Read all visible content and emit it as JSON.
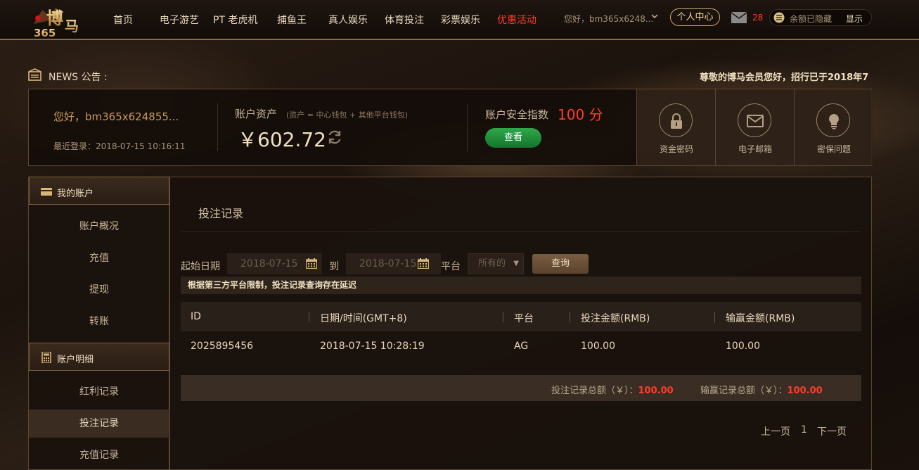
{
  "nav": {
    "items": [
      "首页",
      "电子游艺",
      "PT 老虎机",
      "捕鱼王",
      "真人娱乐",
      "体育投注",
      "彩票娱乐",
      "优惠活动"
    ],
    "greeting": "您好，bm365x6248...",
    "user_center": "个人中心",
    "mail_count": "28",
    "balance_hidden": "余额已隐藏",
    "show_label": "显示"
  },
  "news": {
    "label": "NEWS 公告 :",
    "text": "尊敬的博马会员您好，招行已于2018年7"
  },
  "summary": {
    "greeting": "您好，bm365x624855...",
    "last_login": "最近登录：2018-07-15 10:16:11",
    "asset_title": "账户资产",
    "asset_note": "(资产 = 中心钱包 + 其他平台钱包)",
    "asset_amount": "￥602.72",
    "security_title": "账户安全指数",
    "security_score": "100 分",
    "view_button": "查看",
    "tiles": [
      "资金密码",
      "电子邮箱",
      "密保问题"
    ]
  },
  "sidebar": {
    "section1": "我的账户",
    "items1": [
      "账户概况",
      "充值",
      "提现",
      "转账"
    ],
    "section2": "账户明细",
    "items2": [
      "红利记录",
      "投注记录",
      "充值记录"
    ]
  },
  "main": {
    "title": "投注记录",
    "start_label": "起始日期",
    "start_date": "2018-07-15",
    "to_label": "到",
    "end_date": "2018-07-15",
    "platform_label": "平台",
    "platform_value": "所有的",
    "query_button": "查询",
    "notice": "根据第三方平台限制，投注记录查询存在延迟",
    "columns": [
      "ID",
      "日期/时间(GMT+8)",
      "平台",
      "投注金额(RMB)",
      "输赢金额(RMB)"
    ],
    "rows": [
      [
        "2025895456",
        "2018-07-15 10:28:19",
        "AG",
        "100.00",
        "100.00"
      ]
    ],
    "total_bet_label": "投注记录总额（￥）：",
    "total_bet_value": "100.00",
    "total_win_label": "输赢记录总额（￥）：",
    "total_win_value": "100.00",
    "prev_page": "上一页",
    "page_number": "1",
    "next_page": "下一页"
  },
  "colors": {
    "accent_gold": "#c9a86a",
    "promo_red": "#ff3c2a",
    "view_green": "#2fa84a"
  }
}
